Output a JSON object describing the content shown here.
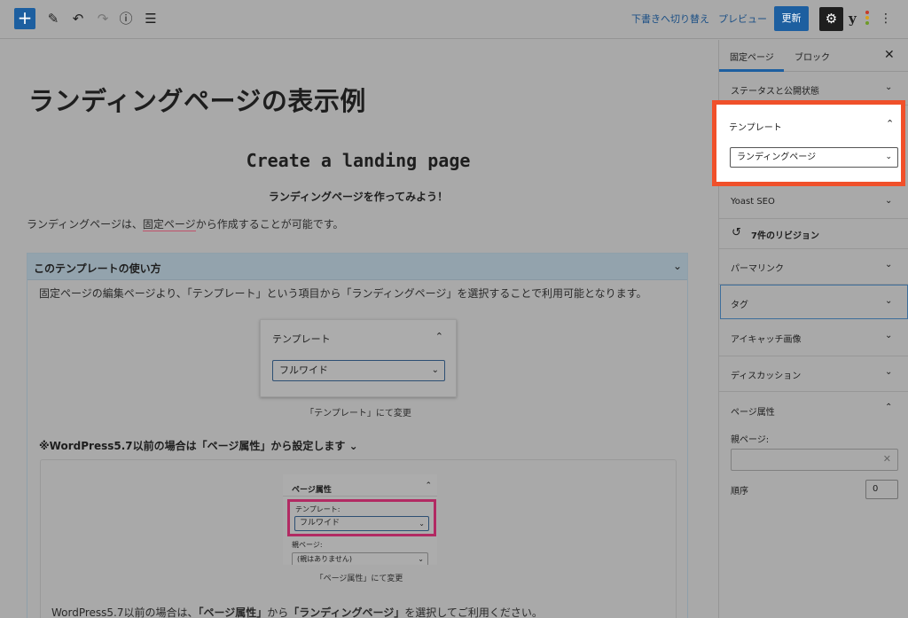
{
  "toolbar": {
    "add_icon": "plus-icon",
    "draft_switch": "下書きへ切り替え",
    "preview": "プレビュー",
    "update": "更新"
  },
  "editor": {
    "page_title": "ランディングページの表示例",
    "heading_en": "Create a landing page",
    "subheading": "ランディングページを作ってみよう！",
    "intro_pre": "ランディングページは、",
    "intro_link": "固定ページ",
    "intro_post": "から作成することが可能です。",
    "accordion": {
      "title": "このテンプレートの使い方",
      "description": "固定ページの編集ページより、「テンプレート」という項目から「ランディングページ」を選択することで利用可能となります。",
      "card1": {
        "title": "テンプレート",
        "selected": "フルワイド",
        "caption": "「テンプレート」にて変更"
      },
      "wp57_heading": "※WordPress5.7以前の場合は「ページ属性」から設定します",
      "card2": {
        "title": "ページ属性",
        "template_label": "テンプレート:",
        "selected": "フルワイド",
        "parent_label": "親ページ:",
        "parent_selected": "(親はありません)",
        "caption": "「ページ属性」にて変更"
      },
      "bottom_pre": "WordPress5.7以前の場合は、",
      "bottom_b1": "「ページ属性」",
      "bottom_mid": "から",
      "bottom_b2": "「ランディングページ」",
      "bottom_post": "を選択してご利用ください。"
    }
  },
  "sidebar": {
    "tab_page": "固定ページ",
    "tab_block": "ブロック",
    "status": "ステータスと公開状態",
    "template": {
      "title": "テンプレート",
      "selected": "ランディングページ"
    },
    "yoast": "Yoast SEO",
    "revisions": "7件のリビジョン",
    "permalink": "パーマリンク",
    "tags": "タグ",
    "featured_image": "アイキャッチ画像",
    "discussion": "ディスカッション",
    "page_attributes": "ページ属性",
    "parent_page_label": "親ページ:",
    "order_label": "順序",
    "order_value": "0"
  },
  "colors": {
    "accent": "#1d5fa0",
    "highlight": "#f0502a",
    "overlay": "#a9a9a9"
  }
}
